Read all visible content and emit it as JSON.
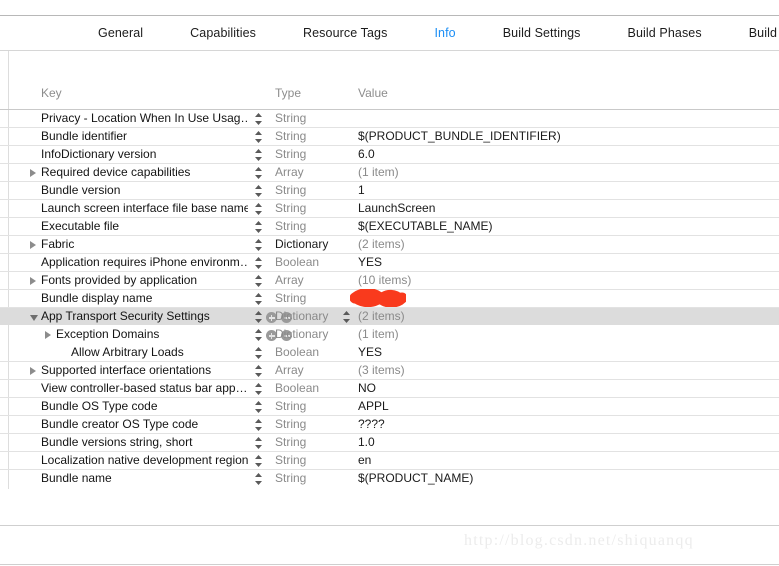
{
  "tabs": [
    {
      "label": "General",
      "selected": false
    },
    {
      "label": "Capabilities",
      "selected": false
    },
    {
      "label": "Resource Tags",
      "selected": false
    },
    {
      "label": "Info",
      "selected": true
    },
    {
      "label": "Build Settings",
      "selected": false
    },
    {
      "label": "Build Phases",
      "selected": false
    },
    {
      "label": "Build Rules",
      "selected": false
    }
  ],
  "colors": {
    "accent": "#1b8ef5",
    "selected_row": "#dcdcdc",
    "row_separator": "#e2e2e2",
    "muted_text": "#8a8a8a",
    "redaction": "#f93a1d"
  },
  "table": {
    "columns": {
      "key": "Key",
      "type": "Type",
      "value": "Value"
    },
    "rows": [
      {
        "key": "Privacy - Location When In Use Usag…",
        "type": "String",
        "value": "",
        "depth": 0,
        "disclosure": "none",
        "selected": false,
        "stepper": true,
        "add_remove": false,
        "value_stepper": false,
        "type_bold": false,
        "value_muted": false
      },
      {
        "key": "Bundle identifier",
        "type": "String",
        "value": "$(PRODUCT_BUNDLE_IDENTIFIER)",
        "depth": 0,
        "disclosure": "none",
        "selected": false,
        "stepper": true,
        "add_remove": false,
        "value_stepper": false,
        "type_bold": false,
        "value_muted": false
      },
      {
        "key": "InfoDictionary version",
        "type": "String",
        "value": "6.0",
        "depth": 0,
        "disclosure": "none",
        "selected": false,
        "stepper": true,
        "add_remove": false,
        "value_stepper": false,
        "type_bold": false,
        "value_muted": false
      },
      {
        "key": "Required device capabilities",
        "type": "Array",
        "value": "(1 item)",
        "depth": 0,
        "disclosure": "collapsed",
        "selected": false,
        "stepper": true,
        "add_remove": false,
        "value_stepper": false,
        "type_bold": false,
        "value_muted": true
      },
      {
        "key": "Bundle version",
        "type": "String",
        "value": "1",
        "depth": 0,
        "disclosure": "none",
        "selected": false,
        "stepper": true,
        "add_remove": false,
        "value_stepper": false,
        "type_bold": false,
        "value_muted": false
      },
      {
        "key": "Launch screen interface file base name",
        "type": "String",
        "value": "LaunchScreen",
        "depth": 0,
        "disclosure": "none",
        "selected": false,
        "stepper": true,
        "add_remove": false,
        "value_stepper": false,
        "type_bold": false,
        "value_muted": false
      },
      {
        "key": "Executable file",
        "type": "String",
        "value": "$(EXECUTABLE_NAME)",
        "depth": 0,
        "disclosure": "none",
        "selected": false,
        "stepper": true,
        "add_remove": false,
        "value_stepper": false,
        "type_bold": false,
        "value_muted": false
      },
      {
        "key": "Fabric",
        "type": "Dictionary",
        "value": "(2 items)",
        "depth": 0,
        "disclosure": "collapsed",
        "selected": false,
        "stepper": true,
        "add_remove": false,
        "value_stepper": false,
        "type_bold": true,
        "value_muted": true
      },
      {
        "key": "Application requires iPhone environm…",
        "type": "Boolean",
        "value": "YES",
        "depth": 0,
        "disclosure": "none",
        "selected": false,
        "stepper": true,
        "add_remove": false,
        "value_stepper": false,
        "type_bold": false,
        "value_muted": false
      },
      {
        "key": "Fonts provided by application",
        "type": "Array",
        "value": "(10 items)",
        "depth": 0,
        "disclosure": "collapsed",
        "selected": false,
        "stepper": true,
        "add_remove": false,
        "value_stepper": false,
        "type_bold": false,
        "value_muted": true
      },
      {
        "key": "Bundle display name",
        "type": "String",
        "value": "",
        "depth": 0,
        "disclosure": "none",
        "selected": false,
        "stepper": true,
        "add_remove": false,
        "value_stepper": false,
        "type_bold": false,
        "value_muted": false,
        "redacted": true
      },
      {
        "key": "App Transport Security Settings",
        "type": "Dictionary",
        "value": "(2 items)",
        "depth": 0,
        "disclosure": "expanded",
        "selected": true,
        "stepper": true,
        "add_remove": true,
        "value_stepper": true,
        "type_bold": false,
        "value_muted": true
      },
      {
        "key": "Exception Domains",
        "type": "Dictionary",
        "value": "(1 item)",
        "depth": 1,
        "disclosure": "collapsed",
        "selected": false,
        "stepper": true,
        "add_remove": true,
        "value_stepper": false,
        "type_bold": false,
        "value_muted": true
      },
      {
        "key": "Allow Arbitrary Loads",
        "type": "Boolean",
        "value": "YES",
        "depth": 2,
        "disclosure": "none",
        "selected": false,
        "stepper": true,
        "add_remove": false,
        "value_stepper": false,
        "type_bold": false,
        "value_muted": false
      },
      {
        "key": "Supported interface orientations",
        "type": "Array",
        "value": "(3 items)",
        "depth": 0,
        "disclosure": "collapsed",
        "selected": false,
        "stepper": true,
        "add_remove": false,
        "value_stepper": false,
        "type_bold": false,
        "value_muted": true
      },
      {
        "key": "View controller-based status bar app…",
        "type": "Boolean",
        "value": "NO",
        "depth": 0,
        "disclosure": "none",
        "selected": false,
        "stepper": true,
        "add_remove": false,
        "value_stepper": false,
        "type_bold": false,
        "value_muted": false
      },
      {
        "key": "Bundle OS Type code",
        "type": "String",
        "value": "APPL",
        "depth": 0,
        "disclosure": "none",
        "selected": false,
        "stepper": true,
        "add_remove": false,
        "value_stepper": false,
        "type_bold": false,
        "value_muted": false
      },
      {
        "key": "Bundle creator OS Type code",
        "type": "String",
        "value": "????",
        "depth": 0,
        "disclosure": "none",
        "selected": false,
        "stepper": true,
        "add_remove": false,
        "value_stepper": false,
        "type_bold": false,
        "value_muted": false
      },
      {
        "key": "Bundle versions string, short",
        "type": "String",
        "value": "1.0",
        "depth": 0,
        "disclosure": "none",
        "selected": false,
        "stepper": true,
        "add_remove": false,
        "value_stepper": false,
        "type_bold": false,
        "value_muted": false
      },
      {
        "key": "Localization native development region",
        "type": "String",
        "value": "en",
        "depth": 0,
        "disclosure": "none",
        "selected": false,
        "stepper": true,
        "add_remove": false,
        "value_stepper": false,
        "type_bold": false,
        "value_muted": false
      },
      {
        "key": "Bundle name",
        "type": "String",
        "value": "$(PRODUCT_NAME)",
        "depth": 0,
        "disclosure": "none",
        "selected": false,
        "stepper": true,
        "add_remove": false,
        "value_stepper": false,
        "type_bold": false,
        "value_muted": false
      }
    ]
  },
  "watermark": "http://blog.csdn.net/shiquanqq"
}
